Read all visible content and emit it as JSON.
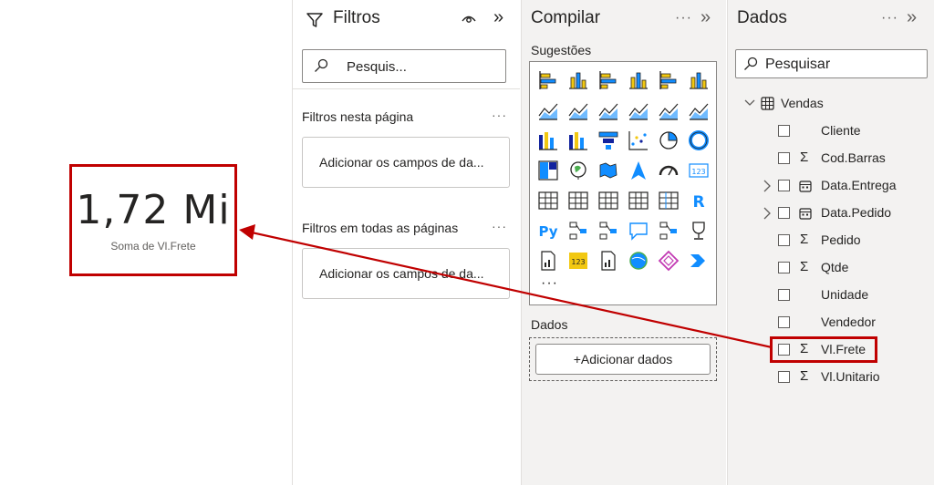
{
  "card": {
    "value": "1,72 Mi",
    "label": "Soma de Vl.Frete"
  },
  "filters": {
    "title": "Filtros",
    "search_placeholder": "Pesquis...",
    "this_page_label": "Filtros nesta página",
    "this_page_add": "Adicionar os campos de da...",
    "all_pages_label": "Filtros em todas as páginas",
    "all_pages_add": "Adicionar os campos de da...",
    "more": "···",
    "collapse": "»"
  },
  "build": {
    "title": "Compilar",
    "suggestions_label": "Sugestões",
    "more_visuals": "···",
    "data_label": "Dados",
    "add_data_button": "+Adicionar dados",
    "more": "···",
    "collapse": "»",
    "visual_icons": [
      "stacked-bar-icon",
      "stacked-column-icon",
      "clustered-bar-icon",
      "clustered-column-icon",
      "100-bar-icon",
      "100-column-icon",
      "line-chart-icon",
      "area-chart-icon",
      "stacked-area-icon",
      "ribbon-icon",
      "line-column-icon",
      "line-stacked-column-icon",
      "ribbon-chart-icon",
      "waterfall-icon",
      "funnel-icon",
      "scatter-icon",
      "pie-chart-icon",
      "donut-chart-icon",
      "treemap-icon",
      "map-icon",
      "filled-map-icon",
      "azure-map-icon",
      "gauge-icon",
      "card-icon",
      "multirow-card-icon",
      "kpi-icon",
      "slicer-icon",
      "table-icon",
      "matrix-icon",
      "r-visual-icon",
      "python-visual-icon",
      "key-influencers-icon",
      "decomposition-tree-icon",
      "qa-icon",
      "narrative-icon",
      "goals-icon",
      "paginated-report-icon",
      "power-apps-icon",
      "power-automate-icon",
      "arcgis-icon",
      "power-apps-diamond-icon",
      "power-automate-flow-icon"
    ],
    "r_letter": "R",
    "py_letters": "Py",
    "card_digits": "123"
  },
  "data": {
    "title": "Dados",
    "search_placeholder": "Pesquisar",
    "more": "···",
    "collapse": "»",
    "table_name": "Vendas",
    "fields": [
      {
        "name": "Cliente",
        "sigma": ""
      },
      {
        "name": "Cod.Barras",
        "sigma": "Σ"
      },
      {
        "name": "Data.Entrega",
        "sigma": ""
      },
      {
        "name": "Data.Pedido",
        "sigma": ""
      },
      {
        "name": "Pedido",
        "sigma": "Σ"
      },
      {
        "name": "Qtde",
        "sigma": "Σ"
      },
      {
        "name": "Unidade",
        "sigma": ""
      },
      {
        "name": "Vendedor",
        "sigma": ""
      },
      {
        "name": "Vl.Frete",
        "sigma": "Σ"
      },
      {
        "name": "Vl.Unitario",
        "sigma": "Σ"
      }
    ]
  },
  "colors": {
    "accent_red": "#c00000",
    "pbi_yellow": "#f2c811",
    "pbi_blue": "#118dff",
    "pbi_navy": "#12239e"
  }
}
